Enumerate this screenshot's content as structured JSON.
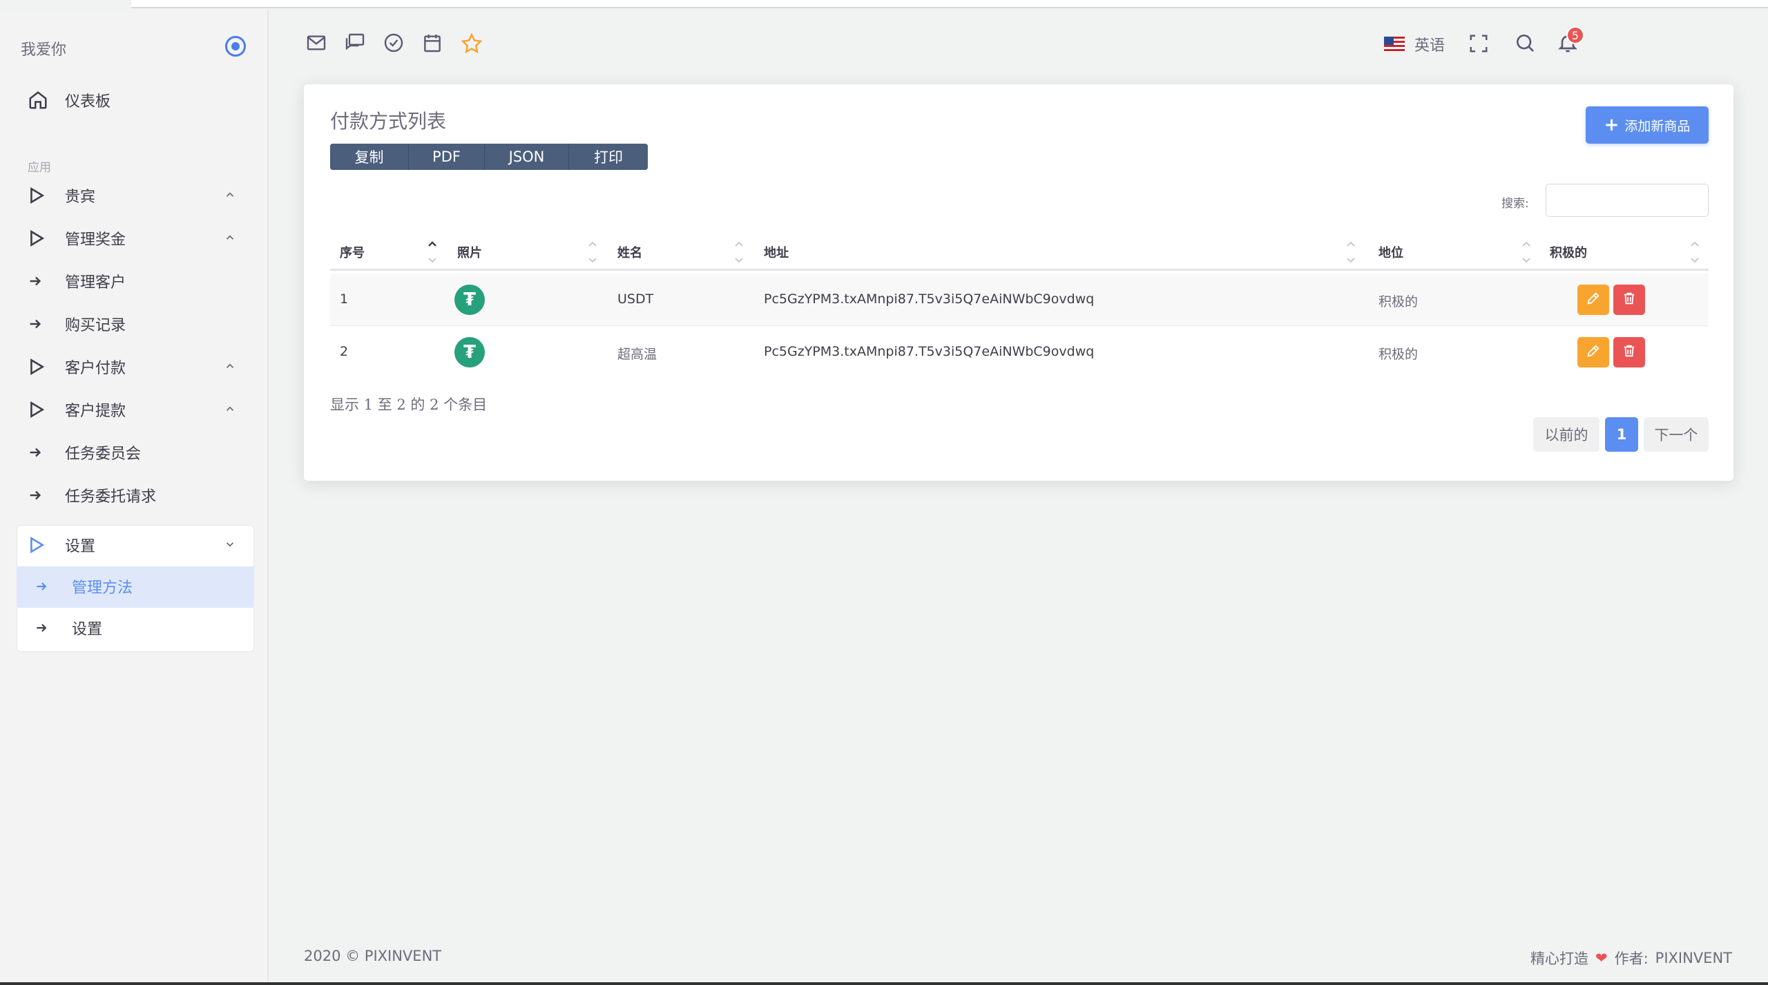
{
  "app": {
    "brand": "我爱你"
  },
  "sidebar": {
    "dashboard": "仪表板",
    "section": "应用",
    "items": [
      {
        "label": "贵宾",
        "icon": "play-triangle-icon",
        "chevron": "chevron-up-icon"
      },
      {
        "label": "管理奖金",
        "icon": "play-triangle-icon",
        "chevron": "chevron-up-icon"
      },
      {
        "label": "管理客户",
        "icon": "arrow-right-icon"
      },
      {
        "label": "购买记录",
        "icon": "arrow-right-icon"
      },
      {
        "label": "客户付款",
        "icon": "play-triangle-icon",
        "chevron": "chevron-up-icon"
      },
      {
        "label": "客户提款",
        "icon": "play-triangle-icon",
        "chevron": "chevron-up-icon"
      },
      {
        "label": "任务委员会",
        "icon": "arrow-right-icon"
      },
      {
        "label": "任务委托请求",
        "icon": "arrow-right-icon"
      }
    ],
    "settings": {
      "label": "设置",
      "children": [
        "管理方法",
        "设置"
      ],
      "active_child": "管理方法"
    }
  },
  "header": {
    "language": "英语",
    "notifications_count": "5"
  },
  "card": {
    "title": "付款方式列表",
    "export_buttons": [
      "复制",
      "PDF",
      "JSON",
      "打印"
    ],
    "add_button": "添加新商品",
    "search_label": "搜索:",
    "columns": [
      "序号",
      "照片",
      "姓名",
      "地址",
      "地位",
      "积极的"
    ],
    "rows": [
      {
        "no": "1",
        "name": "USDT",
        "address": "Pc5GzYPM3.txAMnpi87.T5v3i5Q7eAiNWbC9ovdwq",
        "status": "积极的"
      },
      {
        "no": "2",
        "name": "超高温",
        "address": "Pc5GzYPM3.txAMnpi87.T5v3i5Q7eAiNWbC9ovdwq",
        "status": "积极的"
      }
    ],
    "info": "显示 1 至 2 的 2 个条目",
    "pagination": {
      "prev": "以前的",
      "current": "1",
      "next": "下一个"
    }
  },
  "footer": {
    "copyright": "2020 © PIXINVENT",
    "made_with": "精心打造",
    "author_label": "作者:",
    "author": "PIXINVENT"
  },
  "colors": {
    "primary": "#5b8ef0",
    "warning": "#f8a530",
    "danger": "#ea5455",
    "tether": "#26a17b",
    "export": "#4b5e7c"
  }
}
